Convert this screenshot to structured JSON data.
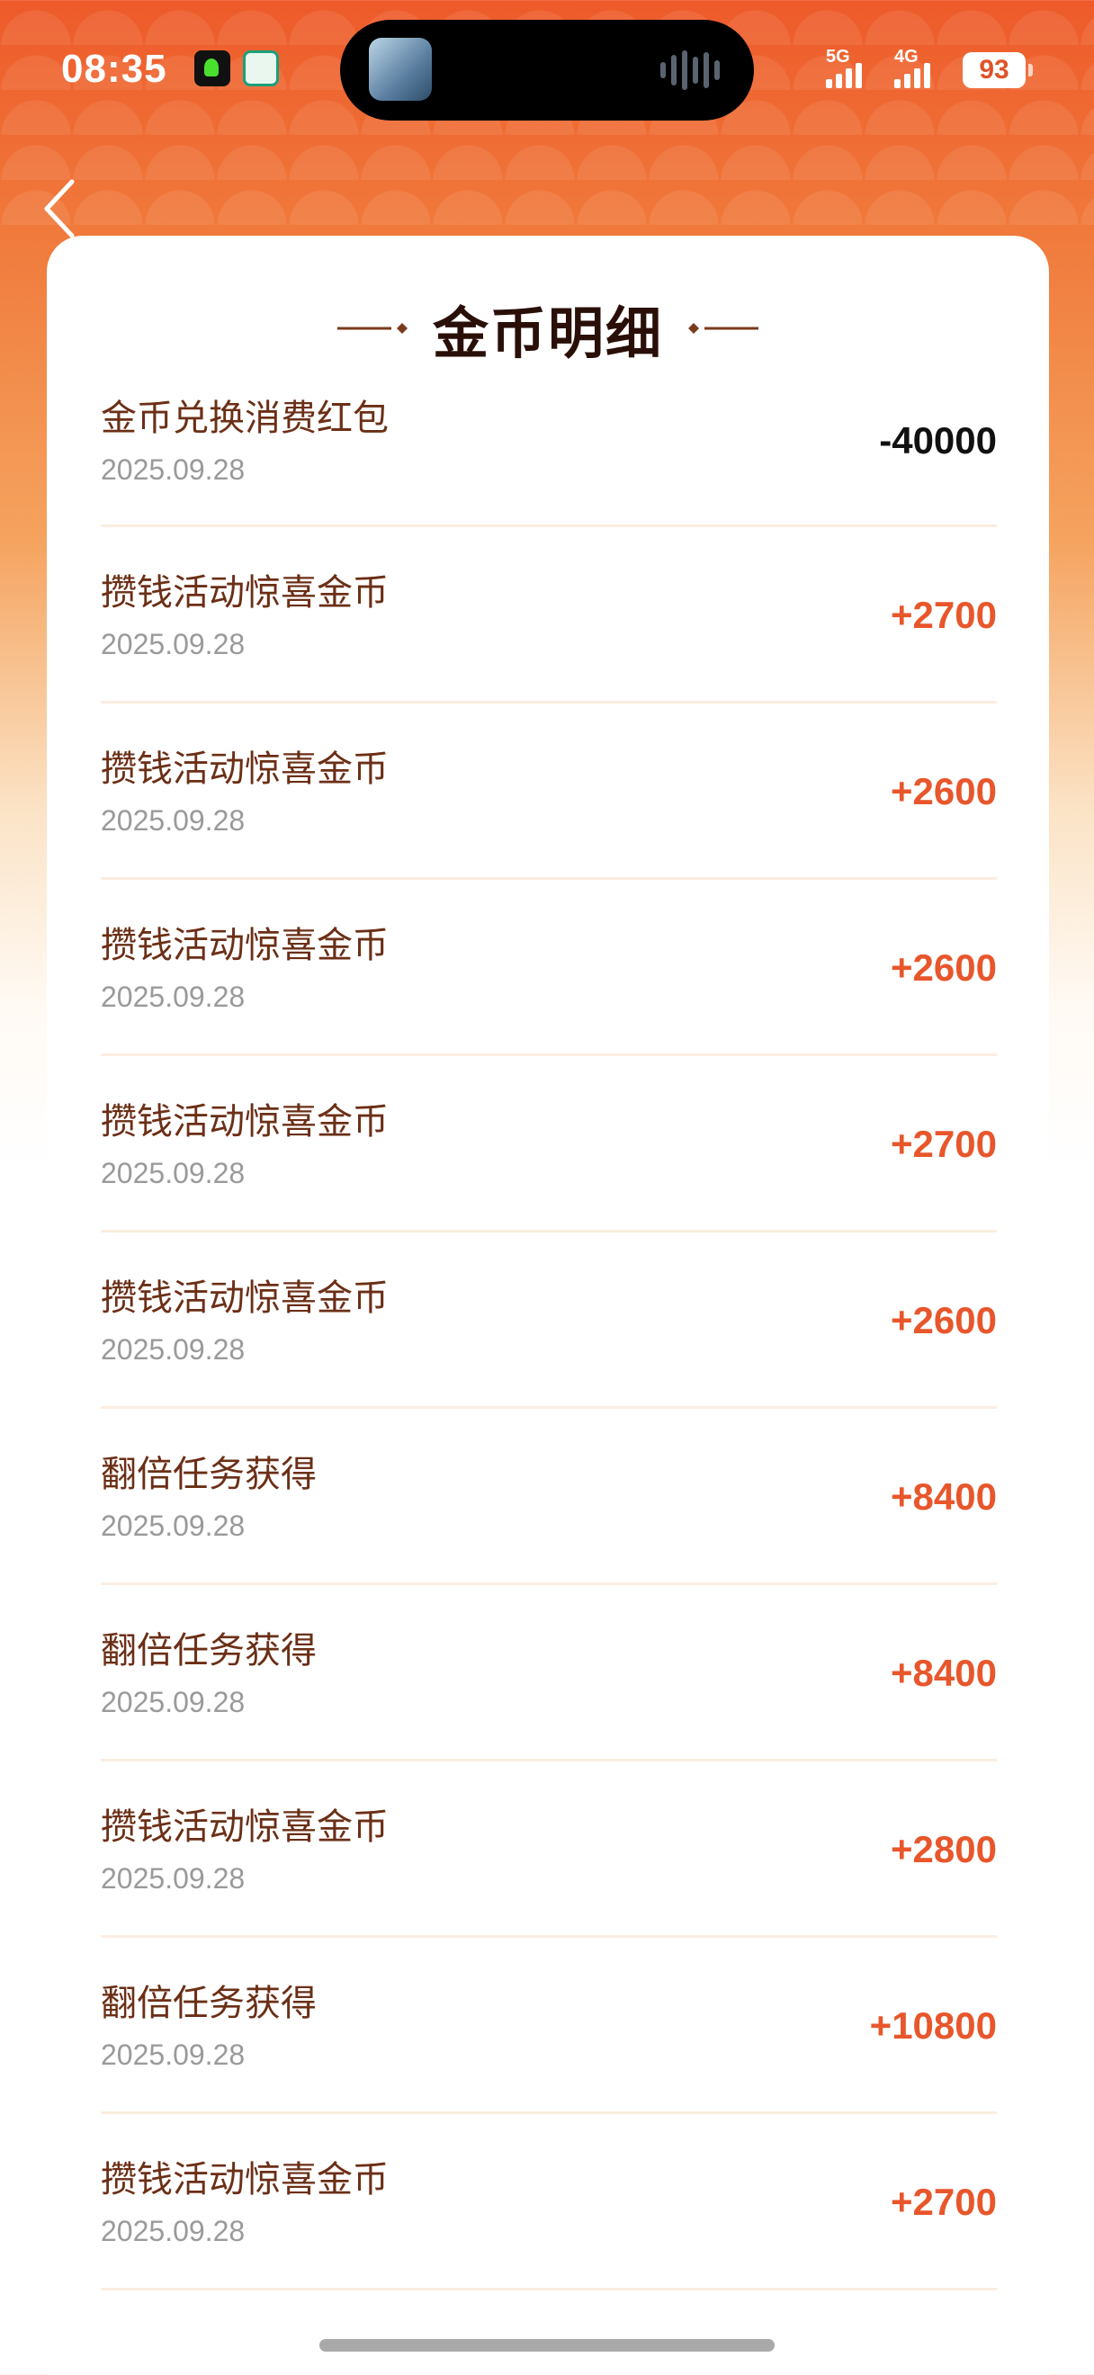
{
  "status_bar": {
    "time": "08:35",
    "signal_1_label": "5G",
    "signal_2_label": "4G",
    "battery": "93"
  },
  "header": {
    "back_icon": "chevron-left-icon",
    "title": "金币明细"
  },
  "colors": {
    "income": "#e8562b",
    "expense": "#111111",
    "title": "#6b2f16",
    "date": "#9a9a9a"
  },
  "records": [
    {
      "title": "金币兑换消费红包",
      "date": "2025.09.28",
      "amount": "-40000"
    },
    {
      "title": "攒钱活动惊喜金币",
      "date": "2025.09.28",
      "amount": "+2700"
    },
    {
      "title": "攒钱活动惊喜金币",
      "date": "2025.09.28",
      "amount": "+2600"
    },
    {
      "title": "攒钱活动惊喜金币",
      "date": "2025.09.28",
      "amount": "+2600"
    },
    {
      "title": "攒钱活动惊喜金币",
      "date": "2025.09.28",
      "amount": "+2700"
    },
    {
      "title": "攒钱活动惊喜金币",
      "date": "2025.09.28",
      "amount": "+2600"
    },
    {
      "title": "翻倍任务获得",
      "date": "2025.09.28",
      "amount": "+8400"
    },
    {
      "title": "翻倍任务获得",
      "date": "2025.09.28",
      "amount": "+8400"
    },
    {
      "title": "攒钱活动惊喜金币",
      "date": "2025.09.28",
      "amount": "+2800"
    },
    {
      "title": "翻倍任务获得",
      "date": "2025.09.28",
      "amount": "+10800"
    },
    {
      "title": "攒钱活动惊喜金币",
      "date": "2025.09.28",
      "amount": "+2700"
    }
  ]
}
